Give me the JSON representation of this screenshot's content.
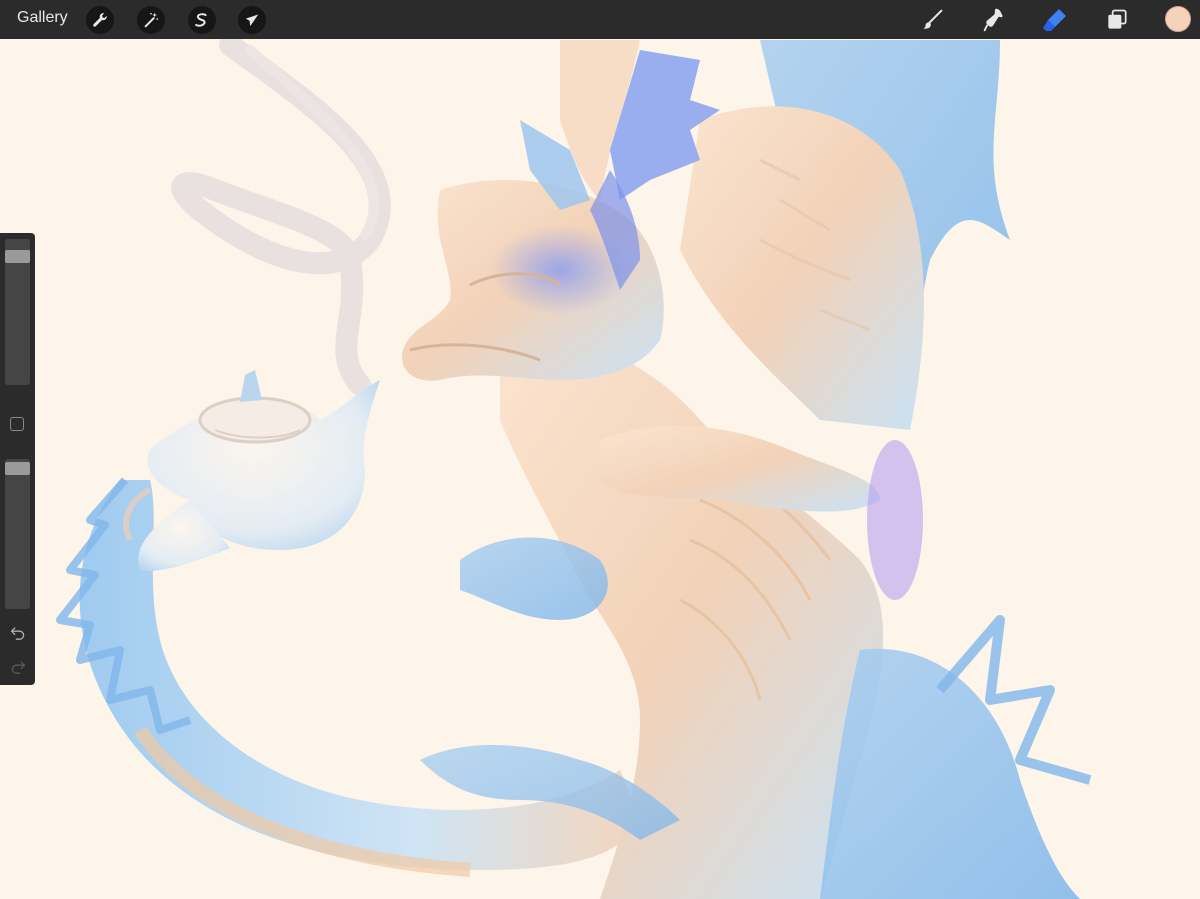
{
  "toolbar": {
    "gallery_label": "Gallery",
    "left_tools": [
      {
        "name": "actions",
        "icon": "wrench-icon"
      },
      {
        "name": "adjustments",
        "icon": "magic-wand-icon"
      },
      {
        "name": "selection",
        "icon": "selection-s-icon"
      },
      {
        "name": "transform",
        "icon": "arrow-cursor-icon"
      }
    ],
    "right_tools": [
      {
        "name": "brush",
        "icon": "brush-icon",
        "active": false
      },
      {
        "name": "smudge",
        "icon": "smudge-icon",
        "active": false
      },
      {
        "name": "eraser",
        "icon": "eraser-icon",
        "active": true
      },
      {
        "name": "layers",
        "icon": "layers-icon",
        "active": false
      }
    ],
    "current_color": "#f7d2bb",
    "active_tool_color": "#3b82f6"
  },
  "sidebar": {
    "brush_size_level": 0.95,
    "opacity_level": 0.95,
    "undo_icon": "undo-icon",
    "redo_icon": "redo-icon",
    "modifier_icon": "square-modifier-icon"
  },
  "canvas": {
    "background": "#fdf5ea",
    "artwork": "dragon-pouring-tea"
  }
}
